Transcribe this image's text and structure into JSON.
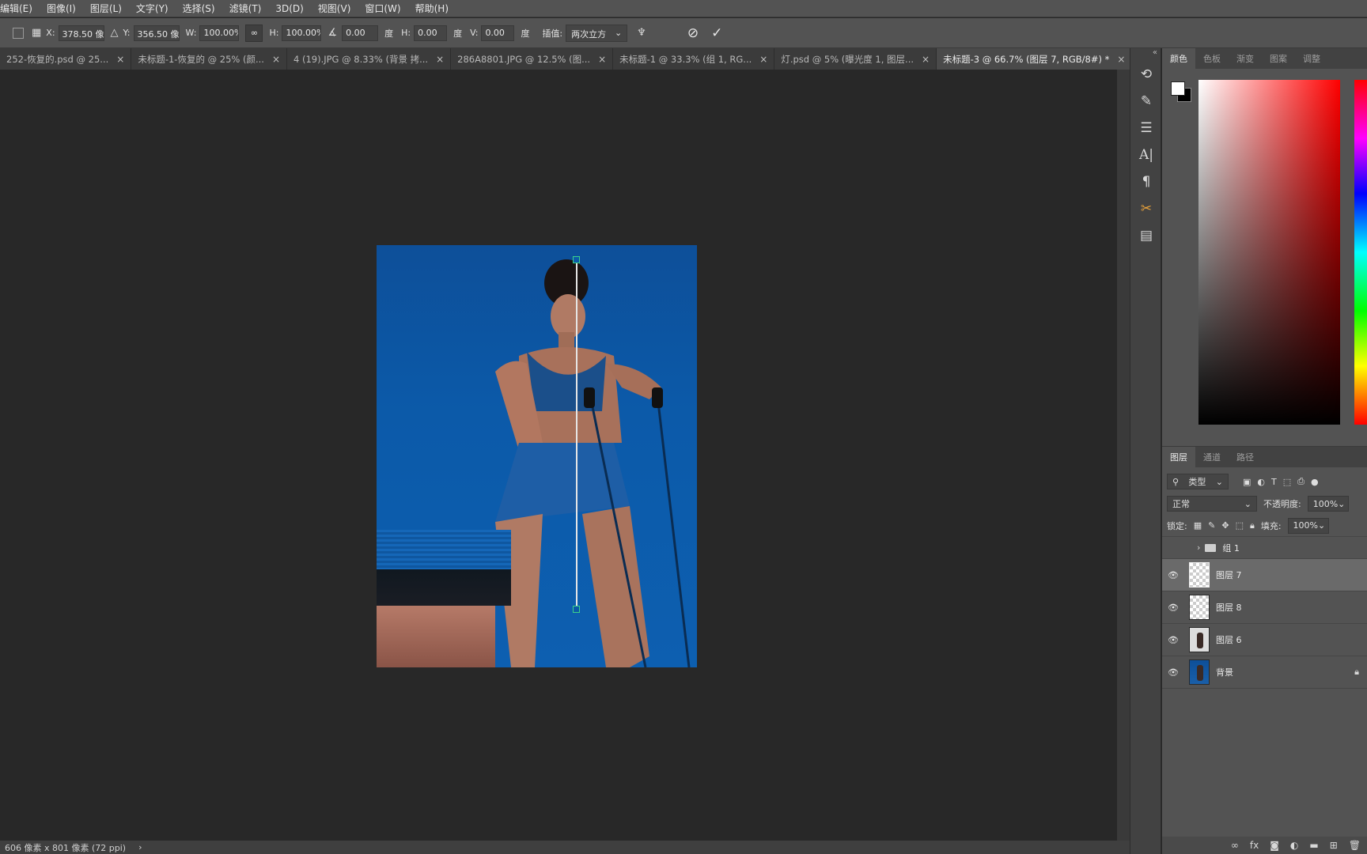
{
  "menu": [
    "编辑(E)",
    "图像(I)",
    "图层(L)",
    "文字(Y)",
    "选择(S)",
    "滤镜(T)",
    "3D(D)",
    "视图(V)",
    "窗口(W)",
    "帮助(H)"
  ],
  "options": {
    "x_label": "X:",
    "x_value": "378.50 像素",
    "y_label": "Y:",
    "y_value": "356.50 像素",
    "w_label": "W:",
    "w_value": "100.00%",
    "link_icon": "link-icon",
    "h_label": "H:",
    "h_value": "100.00%",
    "angle_value": "0.00",
    "angle_unit": "度",
    "hskew_label": "H:",
    "hskew_value": "0.00",
    "hskew_unit": "度",
    "vskew_label": "V:",
    "vskew_value": "0.00",
    "vskew_unit": "度",
    "interp_label": "插值:",
    "interp_value": "两次立方"
  },
  "tabs": [
    {
      "label": "252-恢复的.psd @ 25...",
      "active": false
    },
    {
      "label": "未标题-1-恢复的 @ 25% (颜...",
      "active": false
    },
    {
      "label": "4 (19).JPG @ 8.33% (背景 拷...",
      "active": false
    },
    {
      "label": "286A8801.JPG @ 12.5% (图...",
      "active": false
    },
    {
      "label": "未标题-1 @ 33.3% (组 1, RG...",
      "active": false
    },
    {
      "label": "灯.psd @ 5% (曝光度 1, 图层...",
      "active": false
    },
    {
      "label": "未标题-3 @ 66.7% (图层 7, RGB/8#) *",
      "active": true
    }
  ],
  "color_panel": {
    "tabs": [
      "颜色",
      "色板",
      "渐变",
      "图案",
      "调整"
    ],
    "foreground": "#ffffff",
    "background": "#000000"
  },
  "layers_panel": {
    "tabs": [
      "图层",
      "通道",
      "路径"
    ],
    "filter_label": "类型",
    "blend_mode": "正常",
    "opacity_label": "不透明度:",
    "opacity_value": "100%",
    "lock_label": "锁定:",
    "fill_label": "填充:",
    "fill_value": "100%",
    "group_name": "组 1",
    "layers": [
      {
        "name": "图层 7",
        "selected": true
      },
      {
        "name": "图层 8",
        "selected": false
      },
      {
        "name": "图层 6",
        "selected": false
      },
      {
        "name": "背景",
        "selected": false
      }
    ]
  },
  "status": {
    "doc_info": "606 像素 x 801 像素 (72 ppi)"
  }
}
